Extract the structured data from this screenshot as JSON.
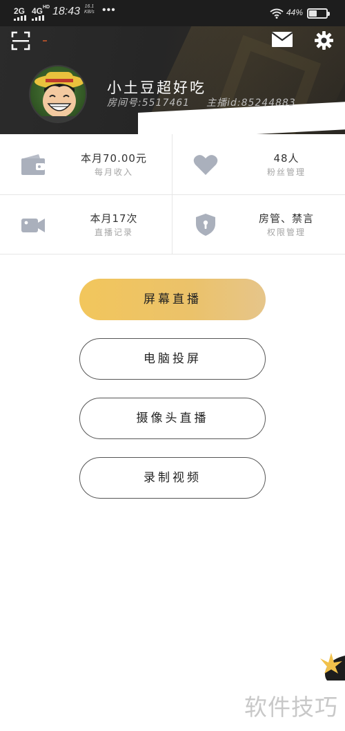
{
  "status_bar": {
    "signal_1": "2G",
    "signal_2": "4G",
    "network_label": "HD",
    "time": "18:43",
    "speed_value": "16.1",
    "speed_unit": "KB/s",
    "more": "•••",
    "battery_text": "44%",
    "battery_level": 0.44
  },
  "header": {
    "username": "小土豆超好吃",
    "room_label": "房间号:",
    "room_number": "5517461",
    "host_label": "主播id:",
    "host_id": "85244883",
    "icons": [
      "scan-icon",
      "mail-icon",
      "gear-icon"
    ]
  },
  "stats": [
    {
      "value": "本月70.00元",
      "label": "每月收入",
      "icon": "wallet-icon"
    },
    {
      "value": "48人",
      "label": "粉丝管理",
      "icon": "heart-icon"
    },
    {
      "value": "本月17次",
      "label": "直播记录",
      "icon": "video-camera-icon"
    },
    {
      "value": "房管、禁言",
      "label": "权限管理",
      "icon": "shield-lock-icon"
    }
  ],
  "actions": {
    "screen_live": "屏幕直播",
    "pc_cast": "电脑投屏",
    "camera_live": "摄像头直播",
    "record_video": "录制视频"
  },
  "watermark": "软件技巧",
  "colors": {
    "header_bg": "#2a2a2a",
    "primary_button": "#f2c65c",
    "icon_gray": "#aab0bc"
  }
}
